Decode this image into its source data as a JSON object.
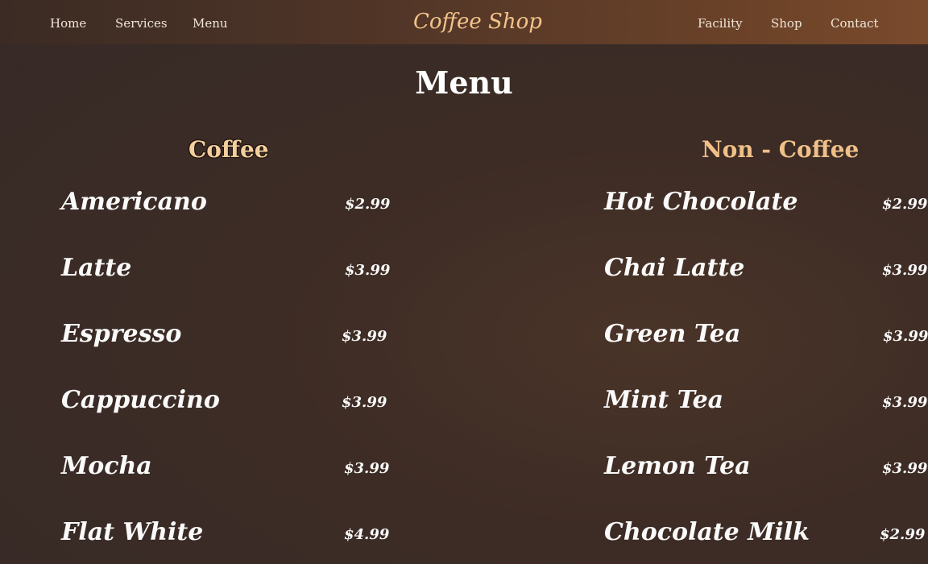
{
  "nav": {
    "left": [
      "Home",
      "Services",
      "Menu"
    ],
    "logo": "Coffee Shop",
    "right": [
      "Facility",
      "Shop",
      "Contact"
    ]
  },
  "page_title": "Menu",
  "coffee": {
    "title": "Coffee",
    "items": [
      {
        "name": "Americano",
        "price": "$2.99"
      },
      {
        "name": "Latte",
        "price": "$3.99"
      },
      {
        "name": "Espresso",
        "price": "$3.99"
      },
      {
        "name": "Cappuccino",
        "price": "$3.99"
      },
      {
        "name": "Mocha",
        "price": "$3.99"
      },
      {
        "name": "Flat White",
        "price": "$4.99"
      }
    ]
  },
  "non_coffee": {
    "title": "Non - Coffee",
    "items": [
      {
        "name": "Hot Chocolate",
        "price": "$2.99"
      },
      {
        "name": "Chai Latte",
        "price": "$3.99"
      },
      {
        "name": "Green Tea",
        "price": "$3.99"
      },
      {
        "name": "Mint Tea",
        "price": "$3.99"
      },
      {
        "name": "Lemon Tea",
        "price": "$3.99"
      },
      {
        "name": "Chocolate Milk",
        "price": "$2.99"
      }
    ]
  }
}
